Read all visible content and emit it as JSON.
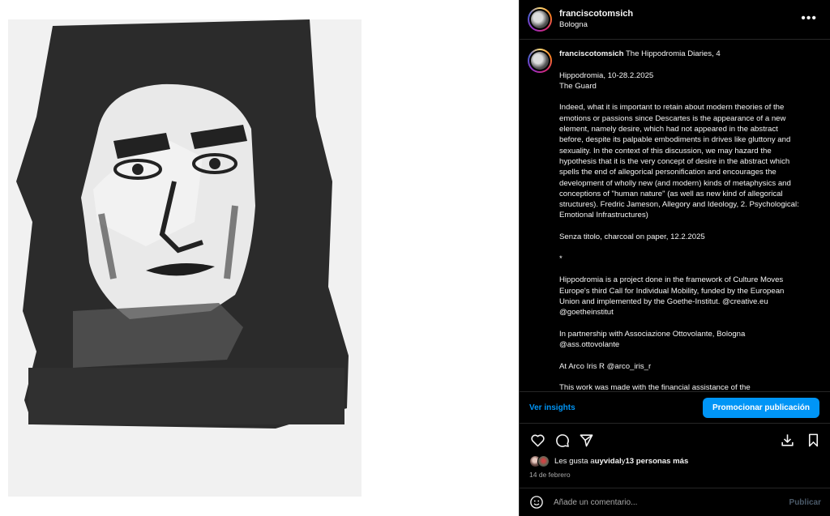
{
  "post": {
    "username": "franciscotomsich",
    "location": "Bologna",
    "image_alt": "Charcoal portrait drawing",
    "caption": {
      "username": "franciscotomsich",
      "title": " The Hippodromia Diaries, 4",
      "body": "\n\nHippodromia, 10-28.2.2025\nThe Guard\n\nIndeed, what it is important to retain about modern theories of the emotions or passions since Descartes is the appearance of a new element, namely desire, which had not appeared in the abstract before, despite its palpable embodiments in drives like gluttony and sexuality. In the context of this discussion, we may hazard the hypothesis that it is the very concept of desire in the abstract which spells the end of allegorical personification and encourages the development of wholly new (and modern) kinds of metaphysics and conceptions of \"human nature\" (as well as new kind of allegorical structures). Fredric Jameson, Allegory and Ideology, 2. Psychological: Emotional Infrastructures)\n\nSenza titolo, charcoal on paper, 12.2.2025\n\n*\n\nHippodromia is a project done in the framework of Culture Moves Europe's third Call for Individual Mobility, funded by the European Union and implemented by the Goethe-Institut. @creative.eu @goetheinstitut\n\nIn partnership with Associazione Ottovolante, Bologna @ass.ottovolante\n\nAt Arco Iris R @arco_iris_r\n\nThis work was made with the financial assistance of the"
    },
    "insights_label": "Ver insights",
    "promote_label": "Promocionar publicación",
    "likes_prefix": "Les gusta a ",
    "likes_user": "uyvidal",
    "likes_middle": " y ",
    "likes_others": "13 personas más",
    "date": "14 de febrero",
    "comment_placeholder": "Añade un comentario...",
    "publish_label": "Publicar"
  },
  "icons": {
    "more": "more-options-icon",
    "like": "heart-icon",
    "comment": "comment-icon",
    "share": "send-icon",
    "download": "download-icon",
    "save": "bookmark-icon",
    "emoji": "emoji-icon"
  },
  "colors": {
    "accent": "#0095f6",
    "panel_bg": "#000000",
    "muted": "#a8a8a8"
  }
}
